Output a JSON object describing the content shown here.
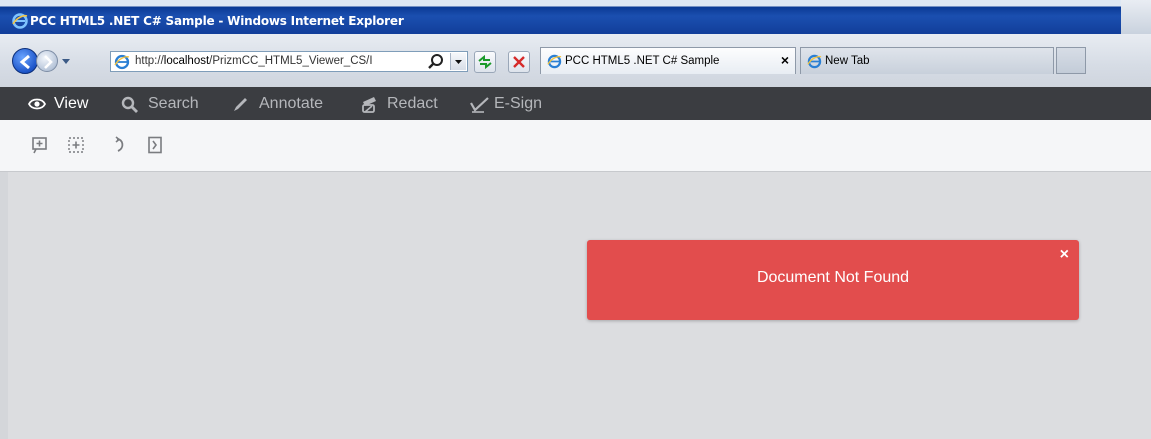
{
  "window": {
    "title": "PCC HTML5 .NET C# Sample - Windows Internet Explorer"
  },
  "address_bar": {
    "url_prefix": "http://",
    "url_host": "localhost",
    "url_path": "/PrizmCC_HTML5_Viewer_CS/I"
  },
  "browser_tabs": [
    {
      "label": "PCC HTML5 .NET C# Sample",
      "close": "×",
      "active": true
    },
    {
      "label": "New Tab",
      "active": false
    }
  ],
  "app_tabs": [
    {
      "label": "View",
      "icon": "eye-icon",
      "active": true
    },
    {
      "label": "Search",
      "icon": "search-icon",
      "active": false
    },
    {
      "label": "Annotate",
      "icon": "pen-icon",
      "active": false
    },
    {
      "label": "Redact",
      "icon": "redact-icon",
      "active": false
    },
    {
      "label": "E-Sign",
      "icon": "signature-icon",
      "active": false
    }
  ],
  "view_tools": [
    {
      "icon": "zoom-in-icon"
    },
    {
      "icon": "zoom-selection-icon"
    },
    {
      "icon": "rotate-icon"
    },
    {
      "icon": "fit-page-icon"
    }
  ],
  "toast": {
    "message": "Document Not Found",
    "close": "×"
  },
  "colors": {
    "toolbar_bg": "#3b3d41",
    "toast_bg": "#e24d4d",
    "content_bg": "#dcdde0"
  }
}
